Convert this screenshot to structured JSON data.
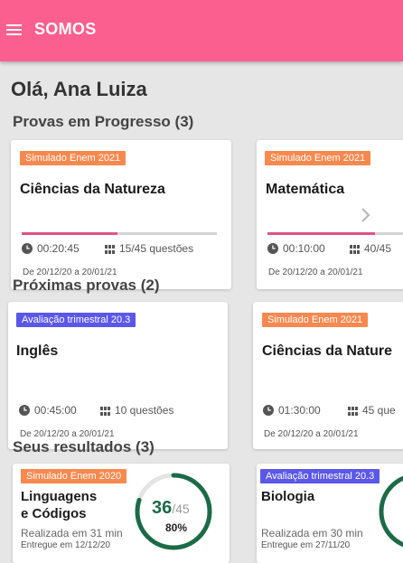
{
  "header": {
    "title": "SOMOS",
    "background": "#fb5f8f"
  },
  "greeting": "Olá, Ana Luiza",
  "sections": {
    "in_progress": {
      "title": "Provas em Progresso (3)",
      "cards": [
        {
          "badge": "Simulado Enem 2021",
          "title": "Ciências da Natureza",
          "progress": 0.49,
          "time": "00:20:45",
          "questions": "15/45 questões",
          "dates": "De 20/12/20 a 20/01/21"
        },
        {
          "badge": "Simulado Enem 2021",
          "title": "Matemática",
          "progress": 0.75,
          "time": "00:10:00",
          "questions": "40/45",
          "dates": "De 20/12/20 a 20/01/21"
        }
      ]
    },
    "upcoming": {
      "title": "Próximas provas (2)",
      "cards": [
        {
          "badge": "Avaliação trimestral 20.3",
          "title": "Inglês",
          "time": "00:45:00",
          "questions": "10 questões",
          "dates": "De 20/12/20 a 20/01/21"
        },
        {
          "badge": "Simulado Enem 2021",
          "title": "Ciências da Nature",
          "time": "01:30:00",
          "questions": "45 que",
          "dates": "De 20/12/20 a 20/01/21"
        }
      ]
    },
    "results": {
      "title": "Seus resultados (3)",
      "cards": [
        {
          "badge": "Simulado Enem 2020",
          "title_line1": "Linguagens",
          "title_line2": "e Códigos",
          "score": "36",
          "score_total": "/45",
          "percent": "80%",
          "percent_value": 0.8,
          "realized": "Realizada em 31 min",
          "delivered": "Entregue em 12/12/20"
        },
        {
          "badge": "Avaliação trimestral 20.3",
          "title_line1": "Biologia",
          "realized": "Realizada em 30 min",
          "delivered": "Entregue em 27/11/20"
        }
      ]
    }
  },
  "icons": {
    "menu": "menu-icon",
    "clock": "clock-icon",
    "grid": "grid-icon",
    "chevron": "chevron-right-icon"
  },
  "colors": {
    "accent": "#fb5f8f",
    "progress": "#e3508a",
    "badge_orange": "#f7894f",
    "badge_purple": "#5b57e8",
    "score_green": "#1b6b47"
  }
}
